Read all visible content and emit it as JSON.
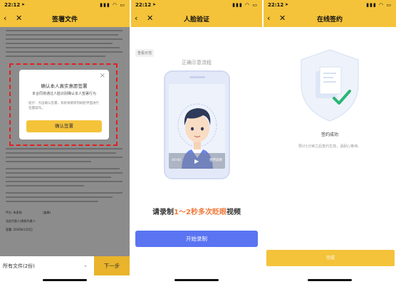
{
  "screens": [
    {
      "status": {
        "time": "22:12",
        "icons": "▮▮▮ ◠ ▭"
      },
      "nav": {
        "back": "‹",
        "close": "✕",
        "title": "签署文件"
      },
      "document": {
        "label_a": "甲方: 朱家铭",
        "label_b": "(盖章)",
        "label_c": "法定代表人/授权代理人:",
        "label_d": "签署: 2020年1月5日"
      },
      "modal": {
        "close": "×",
        "title": "确认本人真实意愿签署",
        "subtitle": "本合同将通过人脸识别确认本人签署行为",
        "hint": "提示：点击确认签署，系统将跳转到刷脸界面进行签署操作。",
        "confirm": "确认签署"
      },
      "bottom": {
        "files": "所有文件(2份)",
        "arrow": "⌃",
        "next": "下一步"
      }
    },
    {
      "status": {
        "time": "22:12",
        "icons": "▮▮▮ ◠ ▭"
      },
      "nav": {
        "back": "‹",
        "close": "✕",
        "title": "人脸验证"
      },
      "guide_tag": "查看示范",
      "guide_title": "正确示意流程",
      "video": {
        "time": "00:00",
        "play": "▶",
        "rec": "使用说明"
      },
      "instruction_pre": "请录制",
      "instruction_hl": "1～2秒多次眨眼",
      "instruction_post": "视频",
      "start": "开始录制"
    },
    {
      "status": {
        "time": "22:12",
        "icons": "▮▮▮ ◠ ▭"
      },
      "nav": {
        "back": "‹",
        "close": "✕",
        "title": "在线签约"
      },
      "success_title": "签约成功",
      "success_desc": "预计1分钟之后签约生效，请耐心等待。",
      "done": "完成"
    }
  ],
  "colors": {
    "brand_yellow": "#f4c33a",
    "primary_blue": "#5a74f2",
    "alert_red": "#e31f1f",
    "accent_orange": "#f07a3a",
    "success_green": "#2bb673"
  }
}
